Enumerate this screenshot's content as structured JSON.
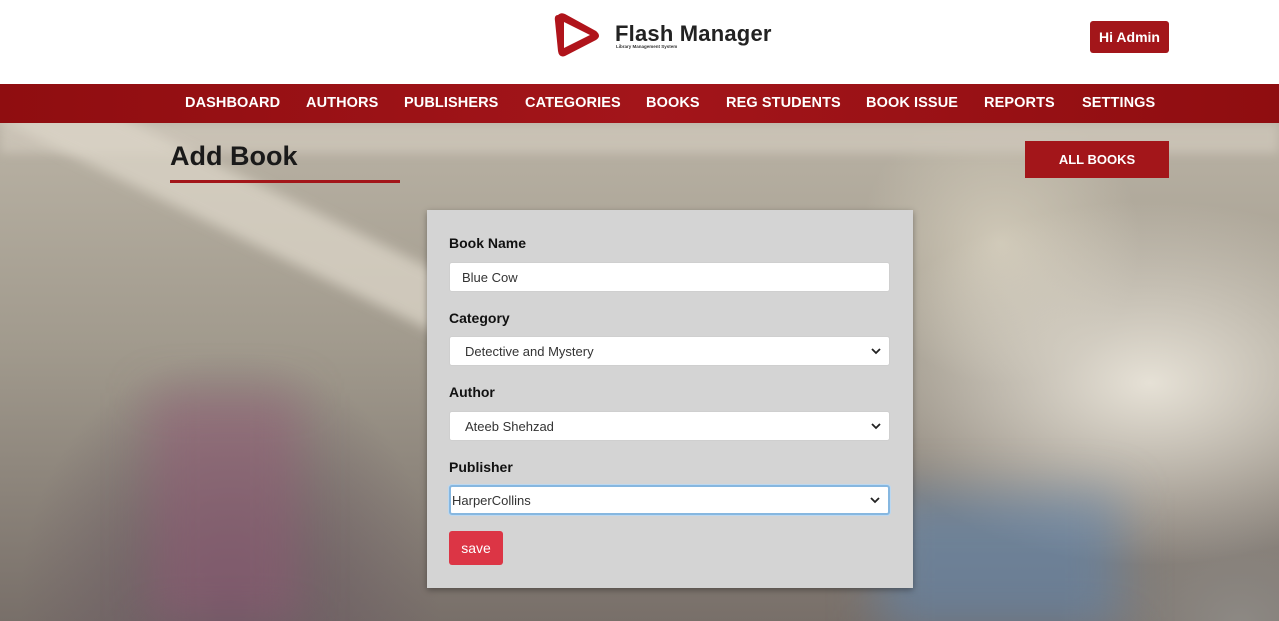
{
  "brand": {
    "title": "Flash Manager",
    "subtitle": "Library Management System",
    "colors": {
      "primary": "#a3161a",
      "save": "#dc3545"
    }
  },
  "header": {
    "user_button": "Hi Admin"
  },
  "nav": {
    "items": [
      {
        "label": "DASHBOARD"
      },
      {
        "label": "AUTHORS"
      },
      {
        "label": "PUBLISHERS"
      },
      {
        "label": "CATEGORIES"
      },
      {
        "label": "BOOKS"
      },
      {
        "label": "REG STUDENTS"
      },
      {
        "label": "BOOK ISSUE"
      },
      {
        "label": "REPORTS"
      },
      {
        "label": "SETTINGS"
      }
    ]
  },
  "page": {
    "title": "Add Book",
    "all_books_button": "ALL BOOKS"
  },
  "form": {
    "book_name": {
      "label": "Book Name",
      "value": "Blue Cow"
    },
    "category": {
      "label": "Category",
      "value": "Detective and Mystery"
    },
    "author": {
      "label": "Author",
      "value": "Ateeb Shehzad"
    },
    "publisher": {
      "label": "Publisher",
      "value": "HarperCollins"
    },
    "save_button": "save"
  }
}
